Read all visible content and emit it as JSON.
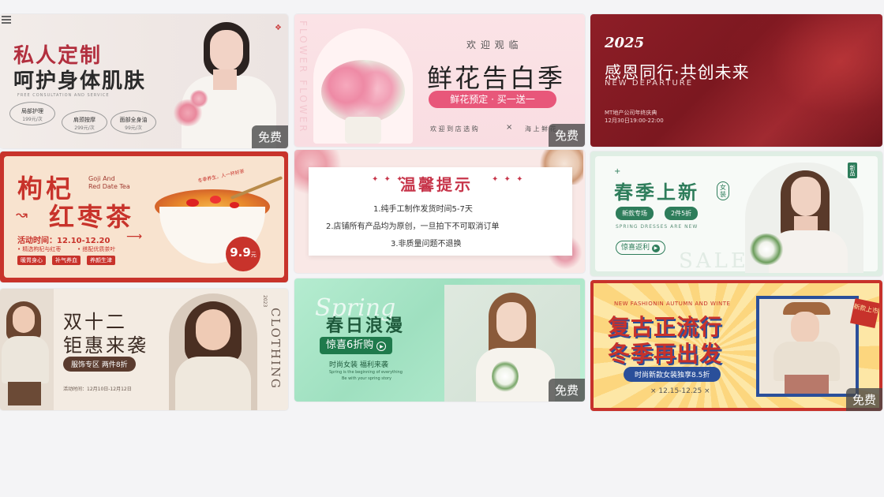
{
  "free_label": "免费",
  "menu_icon": "menu-icon",
  "cards": {
    "c1": {
      "title1": "私人定制",
      "title2": "呵护身体肌肤",
      "subtitle": "FREE CONSULTATION AND SERVICE",
      "badges": [
        {
          "name": "局部护理",
          "price": "199元/次"
        },
        {
          "name": "肩颈按摩",
          "price": "299元/次"
        },
        {
          "name": "面部全身油",
          "price": "99元/次"
        }
      ],
      "accent": "#b22f3e"
    },
    "c2": {
      "welcome": "欢 迎 观 临",
      "title": "鲜花告白季",
      "promo": "鲜花预定 · 买一送一",
      "footer_left": "欢 迎 到 店 选 购",
      "footer_right": "海 上 鲜 花",
      "vertical": "FLOWER FLOWER",
      "accent": "#e8577a"
    },
    "c3": {
      "year": "2025",
      "title": "感恩同行·共创未来",
      "subtitle": "NEW DEPARTURE",
      "company": "MT地产公司年终庆典",
      "time": "12月30日19:00-22:00",
      "accent": "#8a1d25"
    },
    "c4": {
      "title1": "枸杞",
      "title2": "红枣茶",
      "eng": "Goji And\nRed Date Tea",
      "arc": "冬季养生，人一杯好茶",
      "activity": "活动时间：12.10-12.20",
      "bullet1": "• 精选枸杞与红枣",
      "bullet2": "• 搭配优质茶叶",
      "tags": [
        "暖胃身心",
        "补气养血",
        "养颜生津"
      ],
      "price": "9.9",
      "price_unit": "元",
      "accent": "#c8332b"
    },
    "c5": {
      "title": "温馨提示",
      "lines": [
        "1.纯手工制作发货时间5-7天",
        "2.店铺所有产品均为原创，一旦拍下不可取消订单",
        "3.非质量问题不退换"
      ],
      "accent": "#c7354a"
    },
    "c6": {
      "title": "春季上新",
      "badge": "女装",
      "tag1": "新款专场",
      "tag2": "2件5折",
      "eng": "SPRING DRESSES ARE NEW",
      "button": "惊喜返利",
      "sale": "SALE",
      "corner": "新品",
      "accent": "#2e7d5b"
    },
    "c7": {
      "title1": "双十二",
      "title2": "钜惠来袭",
      "tag": "服饰专区  两件8折",
      "time": "活动时间：12月10日-12月12日",
      "vertical": "CLOTHING",
      "year": "2023",
      "accent": "#5a3b2e"
    },
    "c8": {
      "script": "Spring",
      "title": "春日浪漫",
      "button": "惊喜6折购",
      "sub": "时尚女装  福利来袭",
      "small1": "Spring is the beginning of everything",
      "small2": "Be with your spring story",
      "accent": "#1f7a4c"
    },
    "c9": {
      "top": "NEW FASHIONIN AUTUMN AND WINTE",
      "title1": "复古正流行",
      "title2": "冬季再出发",
      "sub": "时尚新款女装独享8.5折",
      "date": "× 12.15-12.25 ×",
      "corner": "新款上市",
      "accent": "#c7322b"
    }
  }
}
